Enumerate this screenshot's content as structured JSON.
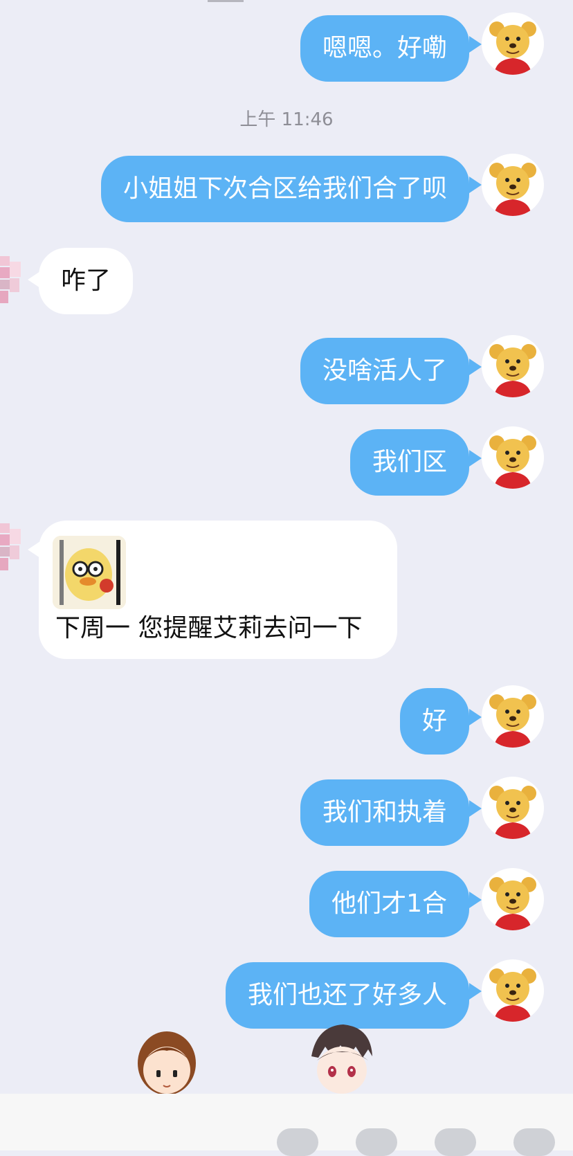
{
  "conversation": {
    "timestamp": "上午 11:46",
    "messages": [
      {
        "side": "out",
        "text": "嗯嗯。好嘞"
      },
      {
        "side": "out",
        "text": "小姐姐下次合区给我们合了呗"
      },
      {
        "side": "in",
        "text": "咋了"
      },
      {
        "side": "out",
        "text": "没啥活人了"
      },
      {
        "side": "out",
        "text": "我们区"
      },
      {
        "side": "in",
        "text": "下周一 您提醒艾莉去问一下",
        "sticker": "duck-sticker"
      },
      {
        "side": "out",
        "text": "好"
      },
      {
        "side": "out",
        "text": "我们和执着"
      },
      {
        "side": "out",
        "text": "他们才1合"
      },
      {
        "side": "out",
        "text": "我们也还了好多人"
      }
    ]
  },
  "icons": {
    "self_avatar": "winnie-the-pooh-avatar",
    "other_avatar": "blurred-pink-avatar",
    "sticker": "yellow-duck-sticker",
    "overlay_left": "girl-cartoon-icon",
    "overlay_right": "boy-cartoon-icon"
  },
  "colors": {
    "background": "#ecedf6",
    "outgoing_bubble": "#5cb3f5",
    "incoming_bubble": "#ffffff",
    "timestamp": "#8e8e96"
  }
}
